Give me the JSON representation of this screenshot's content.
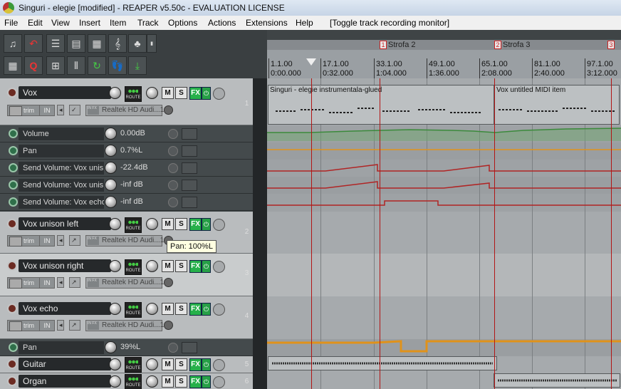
{
  "window": {
    "title": "Singuri - elegie [modified] - REAPER v5.50c - EVALUATION LICENSE"
  },
  "menu": [
    "File",
    "Edit",
    "View",
    "Insert",
    "Item",
    "Track",
    "Options",
    "Actions",
    "Extensions",
    "Help",
    "[Toggle track recording monitor]"
  ],
  "toolbar": {
    "row1": [
      "media-explorer-icon",
      "undo-icon",
      "track-view-icon",
      "mixer-view-icon",
      "grid-view-icon",
      "treble-clef-icon",
      "midi-editor-icon",
      "vst-icon"
    ],
    "row2": [
      "metronome-grid-icon",
      "quantize-icon",
      "snap-icon",
      "routing-matrix-icon",
      "loop-icon",
      "footprints-icon",
      "download-icon"
    ]
  },
  "ruler": {
    "markers": [
      {
        "num": "1",
        "label": "Strofa 2"
      },
      {
        "num": "2",
        "label": "Strofa 3"
      },
      {
        "num": "3",
        "label": ""
      }
    ],
    "ticks": [
      {
        "bar": "1.1.00",
        "time": "0:00.000"
      },
      {
        "bar": "17.1.00",
        "time": "0:32.000"
      },
      {
        "bar": "33.1.00",
        "time": "1:04.000"
      },
      {
        "bar": "49.1.00",
        "time": "1:36.000"
      },
      {
        "bar": "65.1.00",
        "time": "2:08.000"
      },
      {
        "bar": "81.1.00",
        "time": "2:40.000"
      },
      {
        "bar": "97.1.00",
        "time": "3:12.000"
      }
    ]
  },
  "tcp": {
    "route_label": "ROUTE",
    "fx_label": "FX",
    "m_label": "M",
    "s_label": "S",
    "trim_label": "trim",
    "in_label": "IN",
    "input_label": "Realtek HD Audi...1",
    "tracks": [
      {
        "name": "Vox",
        "number": "1"
      },
      {
        "name": "Vox unison left",
        "number": "2"
      },
      {
        "name": "Vox unison right",
        "number": "3"
      },
      {
        "name": "Vox echo",
        "number": "4"
      },
      {
        "name": "Guitar",
        "number": "5"
      },
      {
        "name": "Organ",
        "number": "6"
      }
    ],
    "envelopes_vox": [
      {
        "name": "Volume",
        "value": "0.00dB"
      },
      {
        "name": "Pan",
        "value": "0.7%L"
      },
      {
        "name": "Send Volume: Vox unis",
        "value": "-22.4dB"
      },
      {
        "name": "Send Volume: Vox unis",
        "value": "-inf dB"
      },
      {
        "name": "Send Volume: Vox echo",
        "value": "-inf dB"
      }
    ],
    "envelope_echo": {
      "name": "Pan",
      "value": "39%L"
    }
  },
  "tooltip": {
    "text": "Pan: 100%L"
  },
  "items": {
    "vox_item1": "Singuri - elegie instrumentala-glued",
    "vox_item2": "Vox untitled MIDI item"
  },
  "colors": {
    "volume_env": "#3b8a3b",
    "pan_env": "#e0921a",
    "send_env": "#b02525",
    "marker": "#c21a1a",
    "fx_on": "#26b04a"
  }
}
